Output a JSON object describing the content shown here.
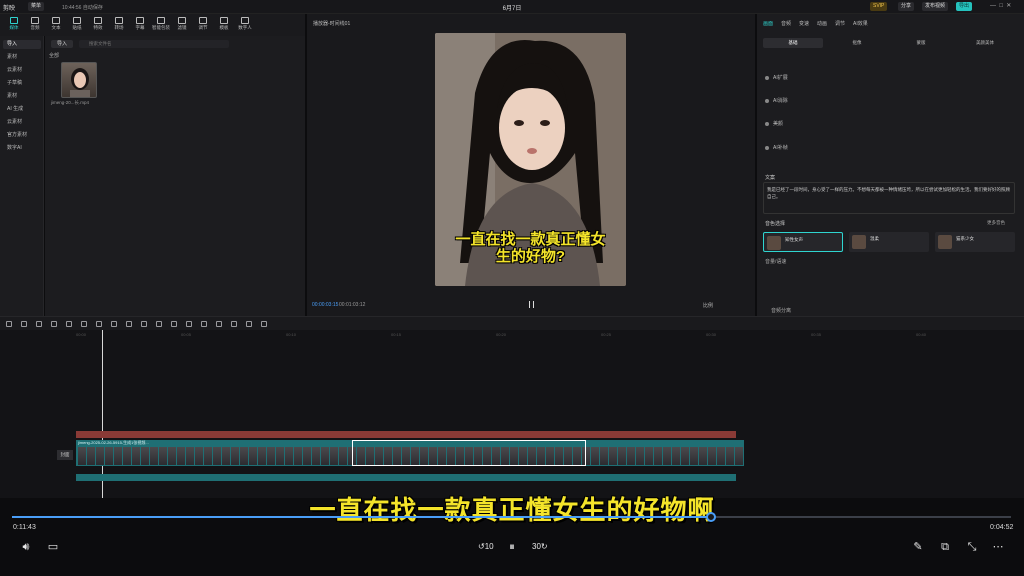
{
  "app": {
    "title": "剪映",
    "window_title": "6月7日",
    "draft_tag": "10:44:56 自动保存",
    "menu_label": "菜单"
  },
  "topbar": {
    "pro_label": "SVIP",
    "share": "分享",
    "export": "导出",
    "publish": "发布视频"
  },
  "tools": [
    {
      "label": "媒体"
    },
    {
      "label": "音频"
    },
    {
      "label": "文本"
    },
    {
      "label": "贴纸"
    },
    {
      "label": "特效"
    },
    {
      "label": "转场"
    },
    {
      "label": "字幕"
    },
    {
      "label": "智能包装"
    },
    {
      "label": "滤镜"
    },
    {
      "label": "调节"
    },
    {
      "label": "模板"
    },
    {
      "label": "数字人"
    }
  ],
  "leftnav": [
    {
      "label": "导入"
    },
    {
      "label": "素材"
    },
    {
      "label": "云素材"
    },
    {
      "label": "子草稿"
    },
    {
      "label": "素材"
    },
    {
      "label": "AI 生成"
    },
    {
      "label": "云素材"
    },
    {
      "label": "官方素材"
    },
    {
      "label": "数字AI"
    }
  ],
  "media": {
    "import_label": "导入",
    "search_placeholder": "搜索文件名",
    "section_label": "全部",
    "thumb_caption": "jimeng-20...长.mp4"
  },
  "player": {
    "title": "播放器-时间线01",
    "current_time": "00:00:03:15",
    "total_time": "00:01:03:12",
    "ratio_label": "比例",
    "video_caption": "一直在找一款真正懂女生的好物?"
  },
  "right": {
    "tabs": [
      "画面",
      "音频",
      "变速",
      "动画",
      "调节",
      "AI效果"
    ],
    "subtabs": [
      "基础",
      "抠像",
      "蒙版",
      "美颜美体"
    ],
    "rows": [
      "AI扩展",
      "AI消除",
      "美颜",
      "AI补帧"
    ],
    "script_label": "文案",
    "script_text": "我是已经了一段时间，身心受了一样的压力。不想每天都被一种情绪压垮，所以在尝试更加轻松的生活。我们要好好的照顾自己。",
    "voice_label": "音色选择",
    "voice_more": "更多音色",
    "voices": [
      {
        "name": "知性女声"
      },
      {
        "name": "温柔"
      },
      {
        "name": "猫系少女"
      }
    ],
    "speed_label": "音量/语速",
    "bottom_row": "音频分离"
  },
  "timeline": {
    "ticks": [
      "00:00",
      "00:05",
      "00:10",
      "00:15",
      "00:20",
      "00:25",
      "00:30",
      "00:35",
      "00:40"
    ],
    "cover_label": "封面",
    "clip_caption": "jimeng-2025-02-26-5915-生成1张视频..."
  },
  "overlay": {
    "subtitle": "一直在找一款真正懂女生的好物啊",
    "elapsed": "0:11:43",
    "remaining": "0:04:52",
    "progress": 0.7
  }
}
